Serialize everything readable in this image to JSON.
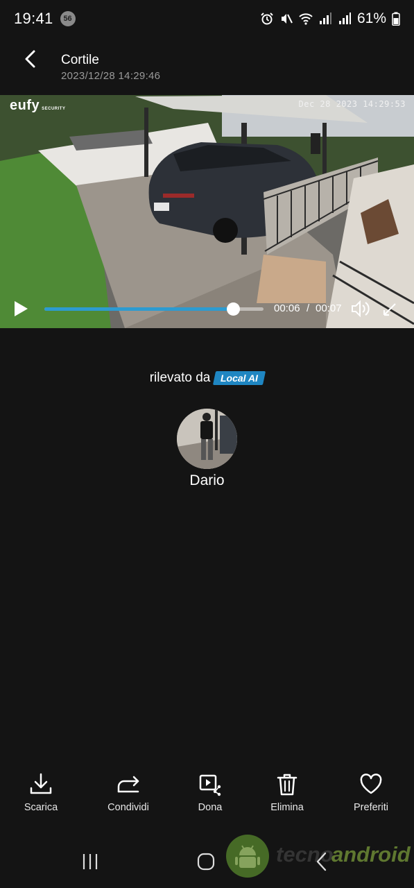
{
  "status_bar": {
    "time": "19:41",
    "notification_count": "56",
    "battery": "61%",
    "icons": [
      "alarm-icon",
      "mute-icon",
      "wifi-icon",
      "signal-icon",
      "signal-icon",
      "battery-icon"
    ]
  },
  "header": {
    "title": "Cortile",
    "datetime": "2023/12/28 14:29:46"
  },
  "video": {
    "brand": "eufy",
    "brand_sub": "SECURITY",
    "camera_stamp": "Dec 28 2023  14:29:53",
    "progress": 0.86,
    "current_time": "00:06",
    "separator": "/",
    "total_time": "00:07"
  },
  "detection": {
    "label": "rilevato da",
    "badge": "Local AI",
    "person_name": "Dario"
  },
  "actions": [
    {
      "label": "Scarica",
      "icon": "download-icon"
    },
    {
      "label": "Condividi",
      "icon": "share-icon"
    },
    {
      "label": "Dona",
      "icon": "donate-video-icon"
    },
    {
      "label": "Elimina",
      "icon": "trash-icon"
    },
    {
      "label": "Preferiti",
      "icon": "heart-icon"
    }
  ],
  "watermark": {
    "left": "tecno",
    "right": "android"
  },
  "colors": {
    "background": "#141414",
    "accent": "#2d9bd0",
    "badge": "#1f86c2"
  }
}
